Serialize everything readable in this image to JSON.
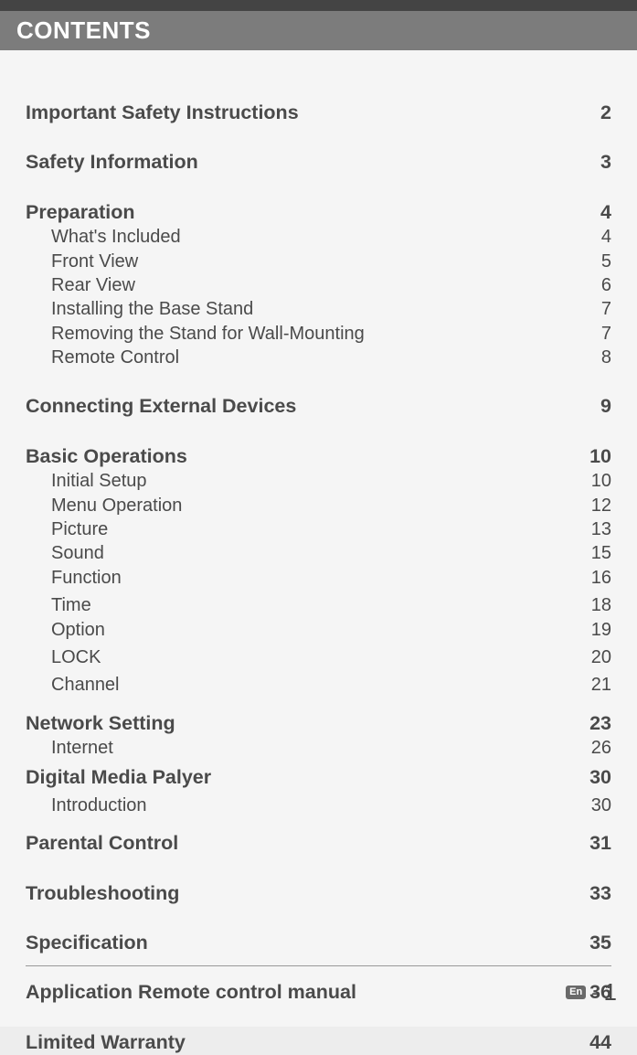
{
  "header": {
    "title": "CONTENTS"
  },
  "toc": {
    "s1": {
      "title": "Important Safety Instructions",
      "page": "2"
    },
    "s2": {
      "title": "Safety Information",
      "page": "3"
    },
    "s3": {
      "title": "Preparation",
      "page": "4",
      "items": [
        {
          "title": "What's Included",
          "page": "4"
        },
        {
          "title": "Front View",
          "page": "5"
        },
        {
          "title": "Rear View",
          "page": "6"
        },
        {
          "title": "Installing the Base Stand",
          "page": "7"
        },
        {
          "title": "Removing the Stand for Wall-Mounting",
          "page": "7"
        },
        {
          "title": "Remote Control",
          "page": "8"
        }
      ]
    },
    "s4": {
      "title": "Connecting External Devices",
      "page": "9"
    },
    "s5": {
      "title": "Basic Operations",
      "page": "10",
      "items": [
        {
          "title": "Initial Setup",
          "page": "10"
        },
        {
          "title": "Menu Operation",
          "page": "12"
        },
        {
          "title": "Picture",
          "page": "13"
        },
        {
          "title": "Sound",
          "page": "15"
        },
        {
          "title": "Function",
          "page": "16"
        },
        {
          "title": "Time",
          "page": "18"
        },
        {
          "title": "Option",
          "page": "19"
        },
        {
          "title": "LOCK",
          "page": "20"
        },
        {
          "title": "Channel",
          "page": "21"
        }
      ]
    },
    "s6": {
      "title": "Network Setting",
      "page": "23",
      "items": [
        {
          "title": "Internet",
          "page": "26"
        }
      ]
    },
    "s7": {
      "title": "Digital Media Palyer",
      "page": "30",
      "items": [
        {
          "title": "Introduction",
          "page": "30"
        }
      ]
    },
    "s8": {
      "title": "Parental Control",
      "page": "31"
    },
    "s9": {
      "title": "Troubleshooting",
      "page": "33"
    },
    "s10": {
      "title": "Specification",
      "page": "35"
    },
    "s11": {
      "title": "Application Remote control manual",
      "page": "36"
    },
    "s12": {
      "title": "Limited Warranty",
      "page": "44"
    }
  },
  "footer": {
    "lang": "En",
    "sep": "-",
    "page": "1"
  }
}
